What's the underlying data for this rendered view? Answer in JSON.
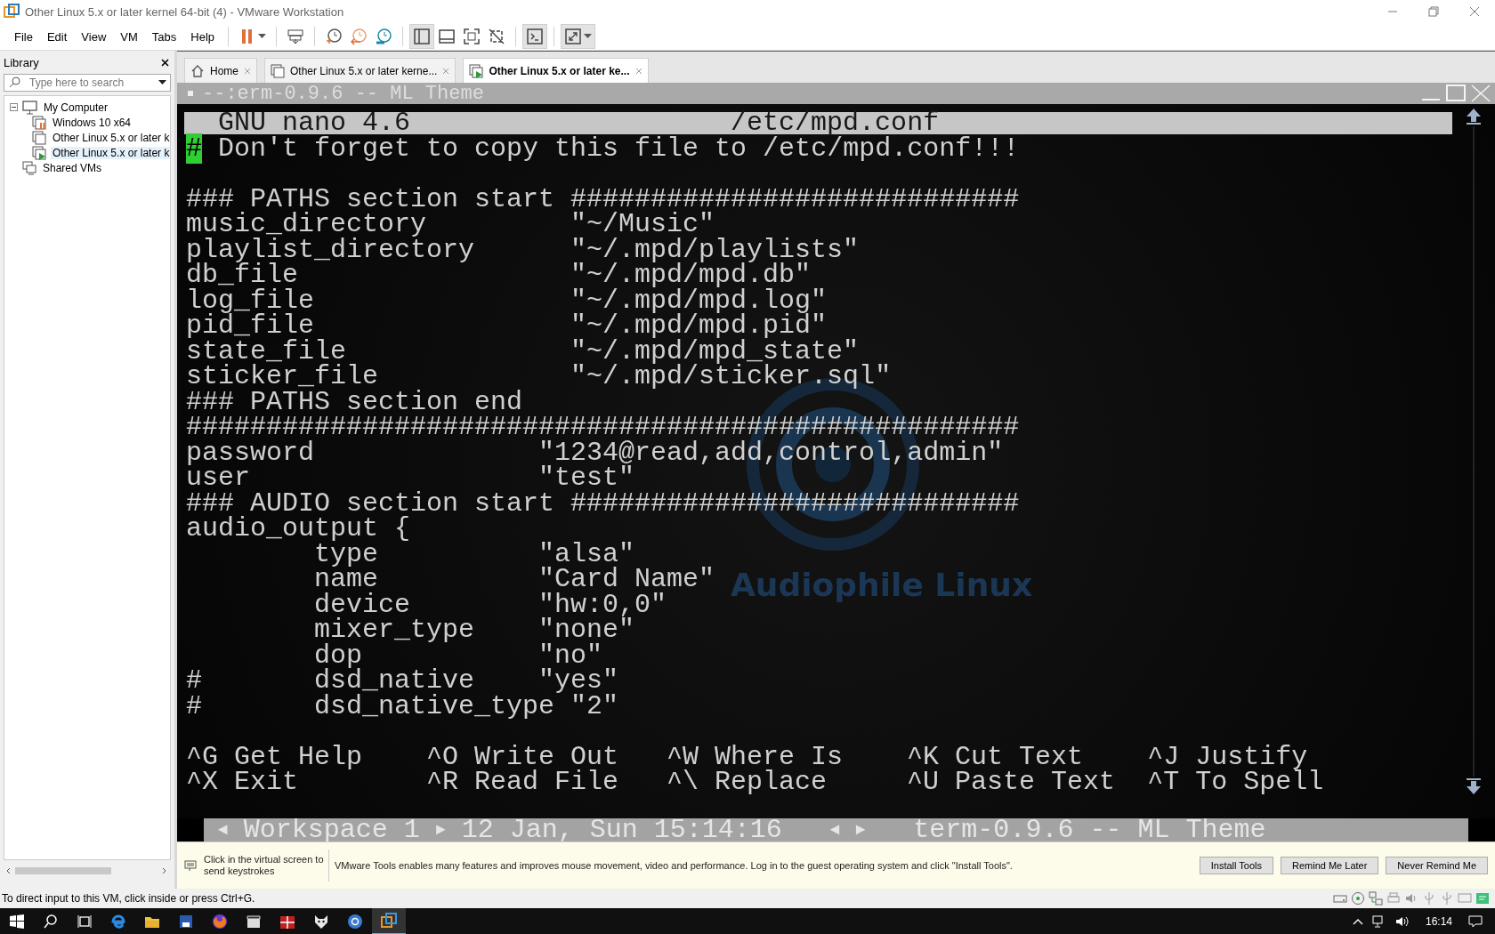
{
  "window": {
    "title": "Other Linux 5.x or later kernel 64-bit (4) - VMware Workstation"
  },
  "menu": [
    "File",
    "Edit",
    "View",
    "VM",
    "Tabs",
    "Help"
  ],
  "toolbar_groups": [
    {
      "items": [
        {
          "kind": "pause",
          "pressed": false
        }
      ]
    },
    {
      "items": [
        {
          "kind": "send-keys",
          "pressed": false
        }
      ]
    },
    {
      "items": [
        {
          "kind": "snapshot",
          "pressed": false
        },
        {
          "kind": "revert",
          "pressed": false
        },
        {
          "kind": "snapshot-manager",
          "pressed": false
        }
      ]
    },
    {
      "items": [
        {
          "kind": "library-view",
          "pressed": true
        },
        {
          "kind": "thumbnail-bar",
          "pressed": false
        },
        {
          "kind": "fullscreen",
          "pressed": false
        },
        {
          "kind": "unity",
          "pressed": false
        }
      ]
    },
    {
      "items": [
        {
          "kind": "console",
          "pressed": true
        }
      ]
    },
    {
      "items": [
        {
          "kind": "stretch",
          "pressed": true
        }
      ]
    }
  ],
  "library": {
    "title": "Library",
    "search": {
      "placeholder": "Type here to search"
    },
    "tree": [
      {
        "label": "My Computer",
        "kind": "computer",
        "expanded": true,
        "selected": false,
        "children": [
          {
            "label": "Windows 10 x64",
            "kind": "vm-paused",
            "selected": false
          },
          {
            "label": "Other Linux 5.x or later k",
            "kind": "vm",
            "selected": false
          },
          {
            "label": "Other Linux 5.x or later k",
            "kind": "vm-running",
            "selected": true
          }
        ]
      },
      {
        "label": "Shared VMs",
        "kind": "shared",
        "selected": false
      }
    ]
  },
  "tabs": [
    {
      "label": "Home",
      "kind": "home",
      "selected": false
    },
    {
      "label": "Other Linux 5.x or later kerne...",
      "kind": "vm",
      "selected": false
    },
    {
      "label": "Other Linux 5.x or later ke...",
      "kind": "vm-running",
      "selected": true
    }
  ],
  "terminal": {
    "title": "--:erm-0.9.6 -- ML Theme",
    "wallpaper": {
      "text": "Audiophile Linux"
    },
    "nano": {
      "version": "GNU nano 4.6",
      "file": "/etc/mpd.conf",
      "lines": [
        {
          "kind": "text",
          "cursor": "#",
          "text": " Don't forget to copy this file to /etc/mpd.conf!!!"
        },
        {
          "kind": "blank"
        },
        {
          "kind": "text",
          "text": "### PATHS section start ############################"
        },
        {
          "kind": "text",
          "text": "music_directory         \"~/Music\""
        },
        {
          "kind": "text",
          "text": "playlist_directory      \"~/.mpd/playlists\""
        },
        {
          "kind": "text",
          "text": "db_file                 \"~/.mpd/mpd.db\""
        },
        {
          "kind": "text",
          "text": "log_file                \"~/.mpd/mpd.log\""
        },
        {
          "kind": "text",
          "text": "pid_file                \"~/.mpd/mpd.pid\""
        },
        {
          "kind": "text",
          "text": "state_file              \"~/.mpd/mpd_state\""
        },
        {
          "kind": "text",
          "text": "sticker_file            \"~/.mpd/sticker.sql\""
        },
        {
          "kind": "text",
          "text": "### PATHS section end"
        },
        {
          "kind": "text",
          "text": "####################################################"
        },
        {
          "kind": "text",
          "text": "password              \"1234@read,add,control,admin\""
        },
        {
          "kind": "text",
          "text": "user                  \"test\""
        },
        {
          "kind": "text",
          "text": "### AUDIO section start ############################"
        },
        {
          "kind": "text",
          "text": "audio_output {"
        },
        {
          "kind": "text",
          "text": "        type          \"alsa\""
        },
        {
          "kind": "text",
          "text": "        name          \"Card Name\""
        },
        {
          "kind": "text",
          "text": "        device        \"hw:0,0\""
        },
        {
          "kind": "text",
          "text": "        mixer_type    \"none\""
        },
        {
          "kind": "text",
          "text": "        dop           \"no\""
        },
        {
          "kind": "text",
          "text": "#       dsd_native    \"yes\""
        },
        {
          "kind": "text",
          "text": "#       dsd_native_type \"2\""
        }
      ],
      "shortcuts": [
        [
          {
            "key": "^G",
            "label": "Get Help"
          },
          {
            "key": "^O",
            "label": "Write Out"
          },
          {
            "key": "^W",
            "label": "Where Is"
          },
          {
            "key": "^K",
            "label": "Cut Text"
          },
          {
            "key": "^J",
            "label": "Justify"
          }
        ],
        [
          {
            "key": "^X",
            "label": "Exit"
          },
          {
            "key": "^R",
            "label": "Read File"
          },
          {
            "key": "^\\",
            "label": "Replace"
          },
          {
            "key": "^U",
            "label": "Paste Text"
          },
          {
            "key": "^T",
            "label": "To Spell"
          }
        ]
      ]
    },
    "workspace_bar": {
      "prev": "◄",
      "workspace": "Workspace 1",
      "next": "►",
      "clock": "12 Jan, Sun 15:14:16",
      "task_prev": "◄",
      "task_next": "►",
      "window": "term-0.9.6 -- ML Theme"
    }
  },
  "notification": {
    "hint": "Click in the virtual screen to send keystrokes",
    "message": "VMware Tools enables many features and improves mouse movement, video and performance. Log in to the guest operating system and click \"Install Tools\".",
    "buttons": [
      "Install Tools",
      "Remind Me Later",
      "Never Remind Me"
    ]
  },
  "status_bar": {
    "text": "To direct input to this VM, click inside or press Ctrl+G."
  },
  "taskbar": {
    "time": "16:14"
  }
}
